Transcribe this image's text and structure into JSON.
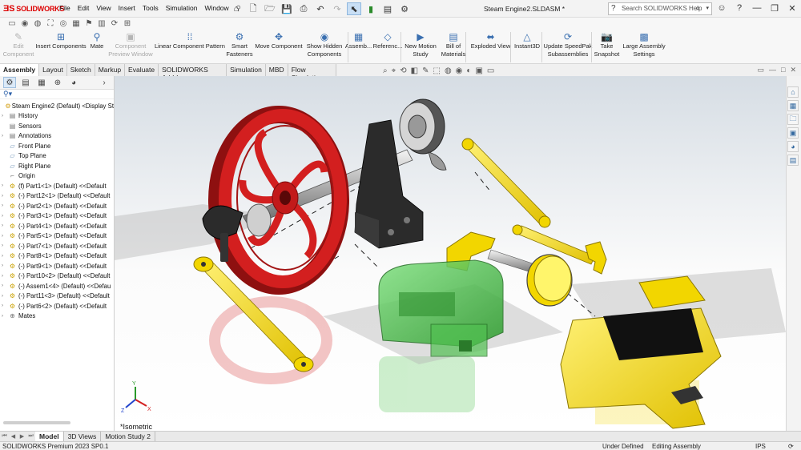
{
  "app": {
    "logo_text": "SOLIDWORKS",
    "document_title": "Steam Engine2.SLDASM *"
  },
  "menu": [
    "File",
    "Edit",
    "View",
    "Insert",
    "Tools",
    "Simulation",
    "Window"
  ],
  "help_search": {
    "placeholder": "Search SOLIDWORKS Help"
  },
  "ribbon": {
    "buttons": [
      {
        "label": "Edit\nComponent",
        "icon": "edit-component-icon",
        "enabled": false
      },
      {
        "label": "Insert Components",
        "icon": "insert-components-icon",
        "enabled": true
      },
      {
        "label": "Mate",
        "icon": "mate-icon",
        "enabled": true
      },
      {
        "label": "Component\nPreview Window",
        "icon": "preview-window-icon",
        "enabled": false
      },
      {
        "label": "Linear Component Pattern",
        "icon": "linear-pattern-icon",
        "enabled": true
      },
      {
        "label": "Smart\nFasteners",
        "icon": "smart-fasteners-icon",
        "enabled": true
      },
      {
        "label": "Move Component",
        "icon": "move-component-icon",
        "enabled": true
      },
      {
        "label": "Show Hidden\nComponents",
        "icon": "show-hidden-icon",
        "enabled": true
      },
      {
        "label": "Assemb...",
        "icon": "assembly-features-icon",
        "enabled": true
      },
      {
        "label": "Referenc...",
        "icon": "reference-geometry-icon",
        "enabled": true
      },
      {
        "label": "New Motion\nStudy",
        "icon": "motion-study-icon",
        "enabled": true
      },
      {
        "label": "Bill of\nMaterials",
        "icon": "bom-icon",
        "enabled": true
      },
      {
        "label": "Exploded View",
        "icon": "exploded-view-icon",
        "enabled": true
      },
      {
        "label": "Instant3D",
        "icon": "instant3d-icon",
        "enabled": true
      },
      {
        "label": "Update SpeedPak\nSubassemblies",
        "icon": "speedpak-icon",
        "enabled": true
      },
      {
        "label": "Take\nSnapshot",
        "icon": "snapshot-icon",
        "enabled": true
      },
      {
        "label": "Large Assembly\nSettings",
        "icon": "large-assembly-icon",
        "enabled": true
      }
    ]
  },
  "command_tabs": [
    "Assembly",
    "Layout",
    "Sketch",
    "Markup",
    "Evaluate",
    "SOLIDWORKS Add-Ins",
    "Simulation",
    "MBD",
    "Flow Simulation"
  ],
  "feature_tree": {
    "filter_symbol": "▾",
    "items": [
      {
        "label": "Steam Engine2 (Default) <Display St",
        "kind": "root",
        "expand": ""
      },
      {
        "label": "History",
        "kind": "folder",
        "expand": "›"
      },
      {
        "label": "Sensors",
        "kind": "folder",
        "expand": ""
      },
      {
        "label": "Annotations",
        "kind": "folder",
        "expand": "›"
      },
      {
        "label": "Front Plane",
        "kind": "plane",
        "expand": ""
      },
      {
        "label": "Top Plane",
        "kind": "plane",
        "expand": ""
      },
      {
        "label": "Right Plane",
        "kind": "plane",
        "expand": ""
      },
      {
        "label": "Origin",
        "kind": "origin",
        "expand": ""
      },
      {
        "label": "(f) Part1<1> (Default) <<Default",
        "kind": "part",
        "expand": "›"
      },
      {
        "label": "(-) Part12<1> (Default) <<Default",
        "kind": "part",
        "expand": "›"
      },
      {
        "label": "(-) Part2<1> (Default) <<Default",
        "kind": "part",
        "expand": "›"
      },
      {
        "label": "(-) Part3<1> (Default) <<Default",
        "kind": "part",
        "expand": "›"
      },
      {
        "label": "(-) Part4<1> (Default) <<Default",
        "kind": "part",
        "expand": "›"
      },
      {
        "label": "(-) Part5<1> (Default) <<Default",
        "kind": "part",
        "expand": "›"
      },
      {
        "label": "(-) Part7<1> (Default) <<Default",
        "kind": "part",
        "expand": "›"
      },
      {
        "label": "(-) Part8<1> (Default) <<Default",
        "kind": "part",
        "expand": "›"
      },
      {
        "label": "(-) Part9<1> (Default) <<Default",
        "kind": "part",
        "expand": "›"
      },
      {
        "label": "(-) Part10<2> (Default) <<Default",
        "kind": "part",
        "expand": "›"
      },
      {
        "label": "(-) Assem1<4> (Default) <<Defau",
        "kind": "assembly",
        "expand": "›"
      },
      {
        "label": "(-) Part11<3> (Default) <<Default",
        "kind": "part",
        "expand": "›"
      },
      {
        "label": "(-) Part6<2> (Default) <<Default",
        "kind": "part",
        "expand": "›"
      },
      {
        "label": "Mates",
        "kind": "mates",
        "expand": "›"
      }
    ]
  },
  "viewport": {
    "view_label": "*Isometric",
    "colors": {
      "flywheel": "#d31f1f",
      "yellow_parts": "#f2d600",
      "cylinder": "#3fbf3f",
      "frame": "#2b2b2b"
    }
  },
  "bottom_tabs": [
    "Model",
    "3D Views",
    "Motion Study 2"
  ],
  "status_bar": {
    "product": "SOLIDWORKS Premium 2023 SP0.1",
    "definition": "Under Defined",
    "mode": "Editing Assembly",
    "units": "IPS"
  }
}
